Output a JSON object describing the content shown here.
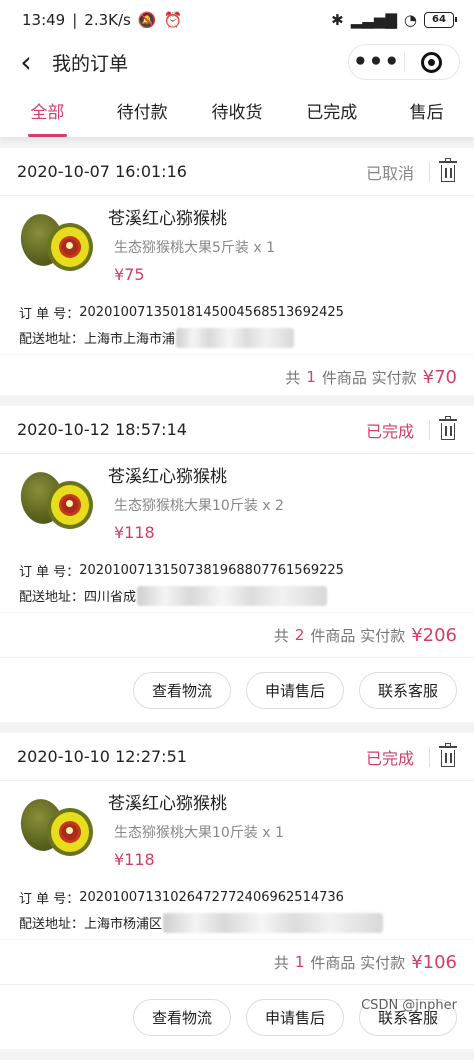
{
  "status_bar": {
    "time": "13:49",
    "speed": "2.3K/s",
    "battery": "64"
  },
  "header": {
    "back_icon": "chevron-left-icon",
    "title": "我的订单"
  },
  "tabs": [
    {
      "label": "全部",
      "active": true
    },
    {
      "label": "待付款",
      "active": false
    },
    {
      "label": "待收货",
      "active": false
    },
    {
      "label": "已完成",
      "active": false
    },
    {
      "label": "售后",
      "active": false
    }
  ],
  "colors": {
    "accent": "#d33f67",
    "muted": "#888888"
  },
  "orders": [
    {
      "date": "2020-10-07 16:01:16",
      "status": "已取消",
      "product_name": "苍溪红心猕猴桃",
      "spec": "生态猕猴桃大果5斤装 x 1",
      "price": "¥75",
      "order_no_label": "订 单 号：",
      "order_no": "202010071350181450045685136924​25",
      "address_label": "配送地址：",
      "address": "上海市上海市浦",
      "count_prefix": "共",
      "count": "1",
      "count_suffix": "件商品 实付款",
      "total": "¥70"
    },
    {
      "date": "2020-10-12 18:57:14",
      "status": "已完成",
      "product_name": "苍溪红心猕猴桃",
      "spec": "生态猕猴桃大果10斤装 x 2",
      "price": "¥118",
      "order_no_label": "订 单 号：",
      "order_no": "20201007131507381968807761569225",
      "address_label": "配送地址：",
      "address": "四川省成",
      "count_prefix": "共",
      "count": "2",
      "count_suffix": "件商品 实付款",
      "total": "¥206",
      "buttons": [
        "查看物流",
        "申请售后",
        "联系客服"
      ]
    },
    {
      "date": "2020-10-10 12:27:51",
      "status": "已完成",
      "product_name": "苍溪红心猕猴桃",
      "spec": "生态猕猴桃大果10斤装 x 1",
      "price": "¥118",
      "order_no_label": "订 单 号：",
      "order_no": "20201007131026472772406962514736",
      "address_label": "配送地址：",
      "address": "上海市杨浦区",
      "count_prefix": "共",
      "count": "1",
      "count_suffix": "件商品 实付款",
      "total": "¥106",
      "buttons": [
        "查看物流",
        "申请售后",
        "联系客服"
      ]
    }
  ],
  "watermark": "CSDN @jnpher"
}
